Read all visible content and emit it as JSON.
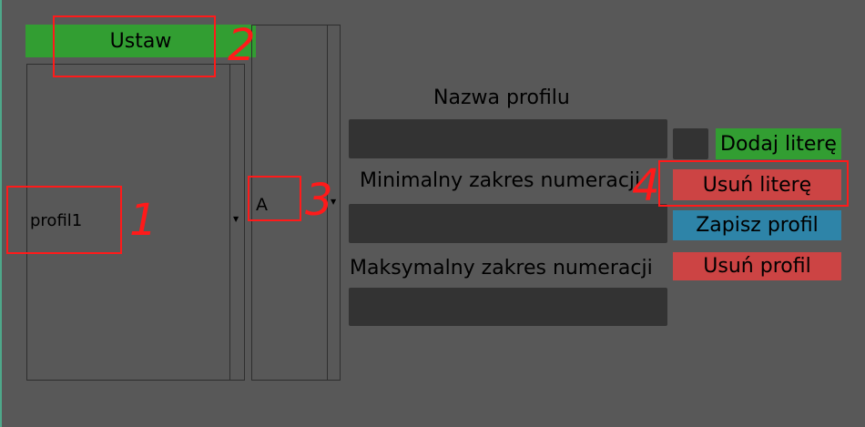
{
  "profiles": {
    "set_button": "Ustaw",
    "items": [
      "profil1"
    ]
  },
  "letters": {
    "items": [
      "A"
    ]
  },
  "form": {
    "profile_name_label": "Nazwa profilu",
    "profile_name_value": "",
    "min_range_label": "Minimalny zakres numeracji",
    "min_range_value": "",
    "max_range_label": "Maksymalny zakres numeracji",
    "max_range_value": "",
    "letter_input_value": ""
  },
  "actions": {
    "add_letter": "Dodaj literę",
    "remove_letter": "Usuń literę",
    "save_profile": "Zapisz profil",
    "remove_profile": "Usuń profil"
  },
  "annotations": [
    "1",
    "2",
    "3",
    "4"
  ],
  "colors": {
    "background": "#585858",
    "field": "#333333",
    "green": "#329e32",
    "red": "#cc4444",
    "blue": "#2e84a8",
    "annotation": "#ff1a1a"
  }
}
